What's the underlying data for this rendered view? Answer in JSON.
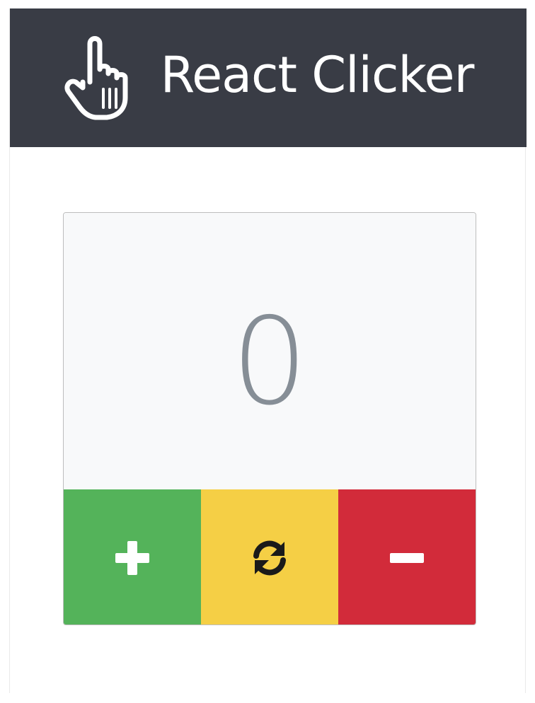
{
  "app": {
    "title": "React Clicker",
    "logo_icon": "pointing-hand-icon"
  },
  "counter": {
    "value": "0"
  },
  "buttons": {
    "increment": {
      "icon": "plus-icon",
      "color": "#54b35a"
    },
    "reset": {
      "icon": "refresh-icon",
      "color": "#f5cf45"
    },
    "decrement": {
      "icon": "minus-icon",
      "color": "#d22b3a"
    }
  },
  "colors": {
    "header_bg": "#393c45",
    "count_text": "#868e96",
    "card_bg": "#f8f9fa"
  }
}
